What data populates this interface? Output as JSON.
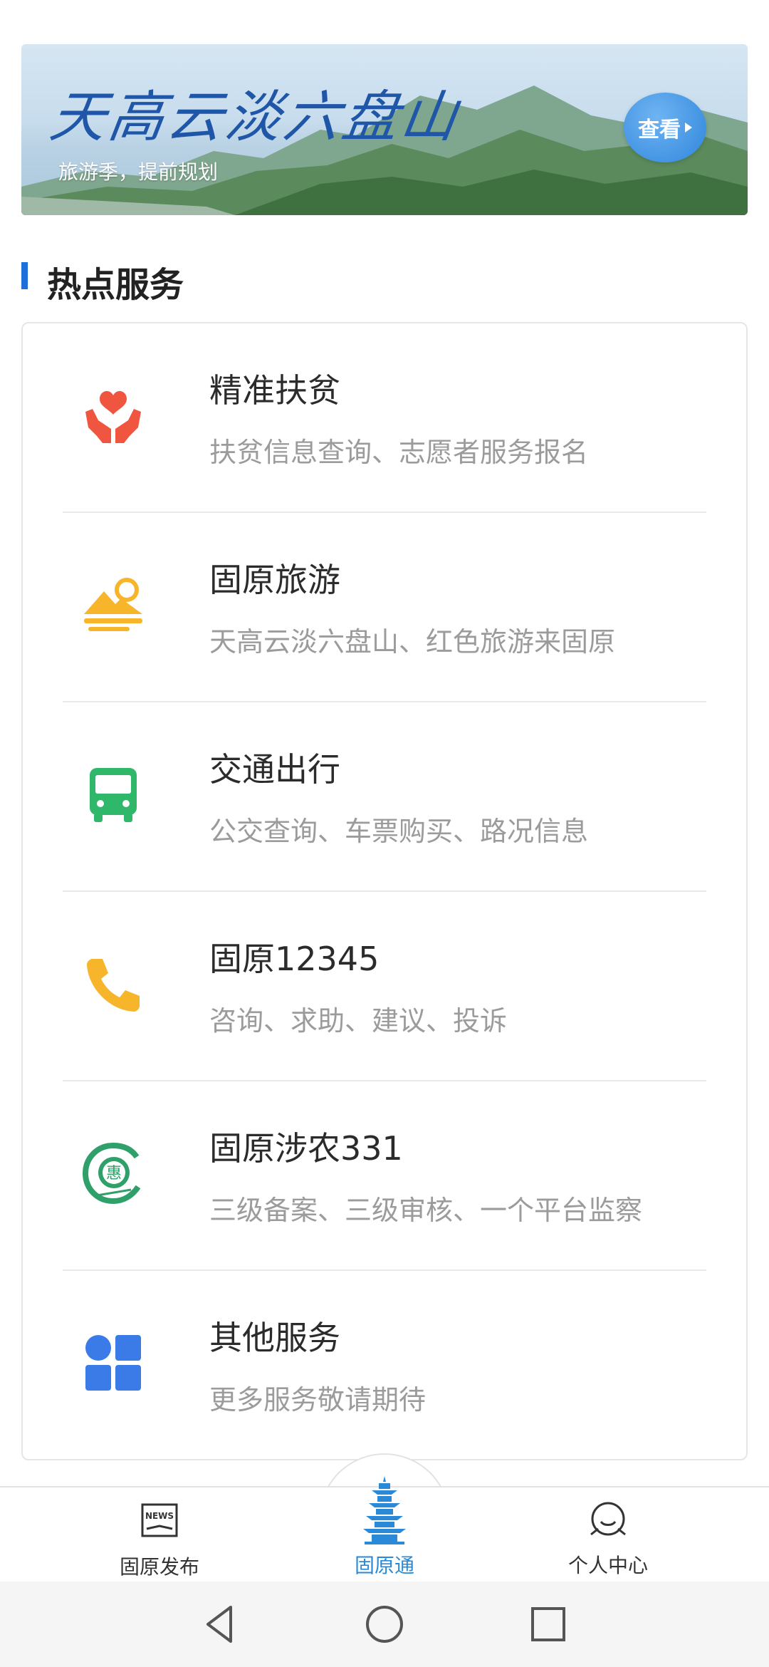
{
  "banner": {
    "title": "天高云淡六盘山",
    "subtitle": "旅游季，提前规划",
    "view_label": "查看"
  },
  "section": {
    "title": "热点服务"
  },
  "services": [
    {
      "title": "精准扶贫",
      "desc": "扶贫信息查询、志愿者服务报名",
      "icon": "hands-heart-icon",
      "color": "#f0553f"
    },
    {
      "title": "固原旅游",
      "desc": "天高云淡六盘山、红色旅游来固原",
      "icon": "mountain-sun-icon",
      "color": "#f7b52b"
    },
    {
      "title": "交通出行",
      "desc": "公交查询、车票购买、路况信息",
      "icon": "bus-icon",
      "color": "#2fb86a"
    },
    {
      "title": "固原12345",
      "desc": "咨询、求助、建议、投诉",
      "icon": "phone-icon",
      "color": "#f7b52b"
    },
    {
      "title": "固原涉农331",
      "desc": "三级备案、三级审核、一个平台监察",
      "icon": "hui-emblem-icon",
      "color": "#2fa06a",
      "icon_text": "惠"
    },
    {
      "title": "其他服务",
      "desc": "更多服务敬请期待",
      "icon": "grid-apps-icon",
      "color": "#3b7be8"
    }
  ],
  "bottom_nav": {
    "items": [
      {
        "label": "固原发布",
        "icon": "news-icon",
        "active": false
      },
      {
        "label": "固原通",
        "icon": "pagoda-icon",
        "active": true
      },
      {
        "label": "个人中心",
        "icon": "user-face-icon",
        "active": false
      }
    ],
    "active_color": "#2a8ad8",
    "news_icon_text": "NEWS"
  },
  "system_nav": [
    "back-icon",
    "home-icon",
    "recents-icon"
  ]
}
